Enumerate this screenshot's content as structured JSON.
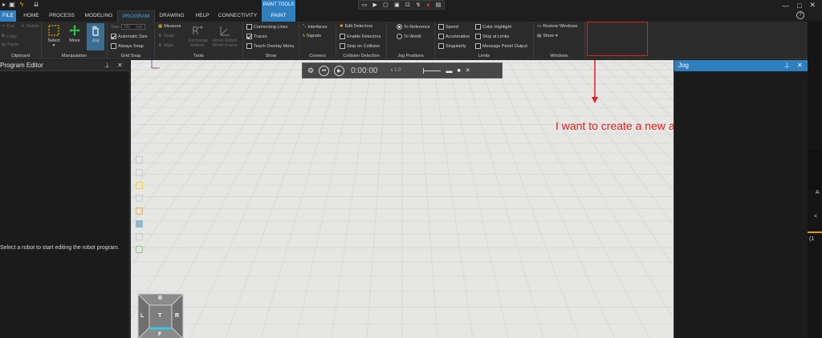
{
  "titlebar": {
    "quick_access": [
      "save-icon",
      "lightning-icon",
      "dropdown-icon"
    ],
    "paint_tools_label": "PAINT TOOLS",
    "window_controls": [
      "minimize-icon",
      "maximize-icon",
      "close-icon"
    ]
  },
  "tabs": [
    {
      "label": "FILE"
    },
    {
      "label": "HOME"
    },
    {
      "label": "PROCESS"
    },
    {
      "label": "MODELING"
    },
    {
      "label": "PROGRAM"
    },
    {
      "label": "DRAWING"
    },
    {
      "label": "HELP"
    },
    {
      "label": "CONNECTIVITY"
    },
    {
      "label": "PAINT"
    }
  ],
  "active_tab": "PROGRAM",
  "ribbon": {
    "clipboard": {
      "label": "Clipboard",
      "cut": "Cut",
      "delete": "Delete",
      "copy": "Copy",
      "paste": "Paste"
    },
    "manipulation": {
      "label": "Manipulation",
      "select": "Select",
      "move": "Move",
      "jog": "Jog"
    },
    "grid_snap": {
      "label": "Grid Snap",
      "size": "Size",
      "size_value": "100",
      "size_unit": "mm",
      "automatic_size": "Automatic Size",
      "always_snap": "Always Snap"
    },
    "tools": {
      "label": "Tools",
      "measure": "Measure",
      "snap": "Snap",
      "align": "Align",
      "exchange_robots": "Exchange Robots",
      "move_robot_world_frame": "Move Robot World Frame"
    },
    "show": {
      "label": "Show",
      "connecting_lines": "Connecting Lines",
      "traces": "Traces",
      "teach_overlay_menu": "Teach Overlay Menu"
    },
    "connect": {
      "label": "Connect",
      "interfaces": "Interfaces",
      "signals": "Signals"
    },
    "collision_detection": {
      "label": "Collision Detection",
      "edit_detectors": "Edit Detectors",
      "enable_detectors": "Enable Detectors",
      "stop_on_collision": "Stop on Collision"
    },
    "jog_positions": {
      "label": "Jog Positions",
      "to_reference": "To Reference",
      "to_world": "To World"
    },
    "limits": {
      "label": "Limits",
      "speed": "Speed",
      "acceleration": "Acceleration",
      "singularity": "Singularity",
      "color_highlight": "Color Highlight",
      "stop_at_limits": "Stop at Limits",
      "message_panel_output": "Message Panel Output"
    },
    "windows": {
      "label": "Windows",
      "restore_windows": "Restore Windows",
      "show": "Show"
    }
  },
  "left_panel": {
    "title": "Program Editor",
    "message": "Select a robot to start editing the robot program."
  },
  "right_panel": {
    "title": "Jog"
  },
  "playback": {
    "time": "0:00:00",
    "speed": "x 1.0"
  },
  "navcube": {
    "top": "B",
    "left": "L",
    "center": "T",
    "right": "R",
    "bottom": "F"
  },
  "annotation": {
    "text": "I want to create a new actionItem here",
    "color": "#e02020"
  },
  "far_strip": {
    "t1": "A",
    "t2": "<",
    "t3": "(1"
  },
  "colors": {
    "accent": "#2f7fbf",
    "active_tab_text": "#4aa3df",
    "viewport_bg": "#e6e7e4"
  }
}
